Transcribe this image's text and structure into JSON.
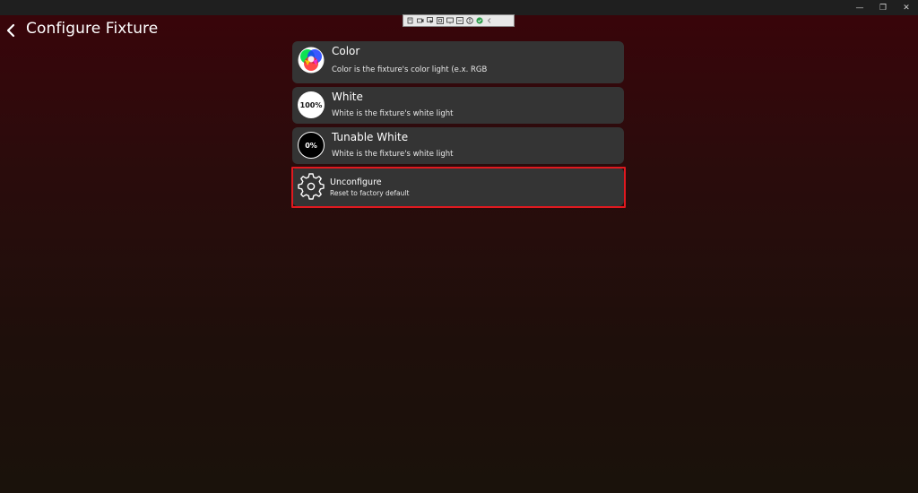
{
  "window": {
    "minimize_glyph": "—",
    "restore_glyph": "❐",
    "close_glyph": "✕"
  },
  "header": {
    "back_icon": "chevron-left-icon",
    "title": "Configure Fixture"
  },
  "options": [
    {
      "id": "color",
      "title": "Color",
      "description": "Color is the fixture's color light (e.x. RGB",
      "icon": "rgb-color-wheel-icon"
    },
    {
      "id": "white",
      "title": "White",
      "description": "White is the fixture's white light",
      "icon_label": "100%",
      "icon": "white-level-icon"
    },
    {
      "id": "tunable_white",
      "title": "Tunable White",
      "description": "White is the fixture's white light",
      "icon_label": "0%",
      "icon": "tunable-white-icon"
    },
    {
      "id": "unconfigure",
      "title": "Unconfigure",
      "description": "Reset to factory default",
      "icon": "gear-icon",
      "highlighted": true
    }
  ],
  "colors": {
    "card_bg": "#343434",
    "highlight_border": "#e0191f",
    "bg_top": "#3a040a",
    "bg_bottom": "#1a120b"
  }
}
